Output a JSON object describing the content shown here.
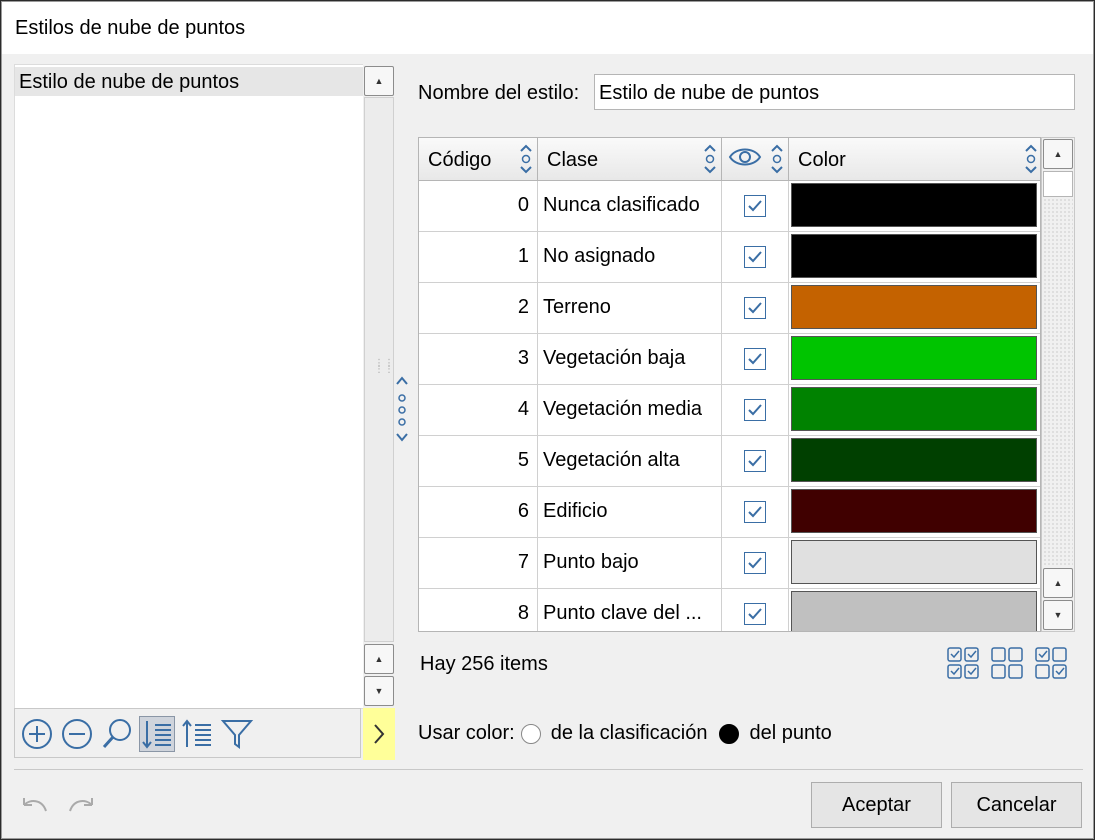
{
  "window": {
    "title": "Estilos de nube de puntos"
  },
  "left_list": {
    "items": [
      "Estilo de nube de puntos"
    ]
  },
  "form": {
    "name_label": "Nombre del estilo:",
    "name_value": "Estilo de nube de puntos"
  },
  "grid": {
    "columns": [
      "Código",
      "Clase",
      "",
      "Color"
    ],
    "rows": [
      {
        "code": "0",
        "class": "Nunca clasificado",
        "visible": true,
        "color": "#000000"
      },
      {
        "code": "1",
        "class": "No asignado",
        "visible": true,
        "color": "#000000"
      },
      {
        "code": "2",
        "class": "Terreno",
        "visible": true,
        "color": "#c46200"
      },
      {
        "code": "3",
        "class": "Vegetación baja",
        "visible": true,
        "color": "#00c400"
      },
      {
        "code": "4",
        "class": "Vegetación media",
        "visible": true,
        "color": "#008200"
      },
      {
        "code": "5",
        "class": "Vegetación alta",
        "visible": true,
        "color": "#004000"
      },
      {
        "code": "6",
        "class": "Edificio",
        "visible": true,
        "color": "#400000"
      },
      {
        "code": "7",
        "class": "Punto bajo",
        "visible": true,
        "color": "#e0e0e0"
      },
      {
        "code": "8",
        "class": "Punto clave del ...",
        "visible": true,
        "color": "#c0c0c0"
      }
    ]
  },
  "status": {
    "items_count": "Hay 256 items"
  },
  "use_color": {
    "label": "Usar color:",
    "option_class": "de la clasificación",
    "option_point": "del punto",
    "selected": "del punto"
  },
  "buttons": {
    "accept": "Aceptar",
    "cancel": "Cancelar"
  },
  "colors": {
    "accent": "#3a6ea5",
    "highlight": "#ffff99"
  }
}
